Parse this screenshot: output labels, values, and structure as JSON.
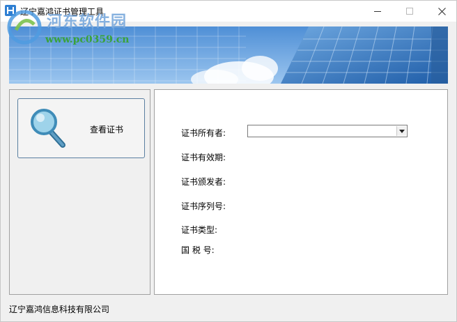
{
  "window": {
    "title": "辽宁嘉鸿证书管理工具",
    "watermark_title": "河东软件园",
    "watermark_url": "www.pc0359.cn"
  },
  "sidebar": {
    "view_cert_label": "查看证书"
  },
  "form": {
    "owner_label": "证书所有者:",
    "owner_value": "",
    "validity_label": "证书有效期:",
    "issuer_label": "证书颁发者:",
    "serial_label": "证书序列号:",
    "type_label": "证书类型:",
    "tax_label": "国 税 号:"
  },
  "status": {
    "company": "辽宁嘉鸿信息科技有限公司"
  },
  "icons": {
    "app": "app-logo-icon",
    "view_cert": "magnifier-icon",
    "dropdown": "chevron-down-icon"
  }
}
